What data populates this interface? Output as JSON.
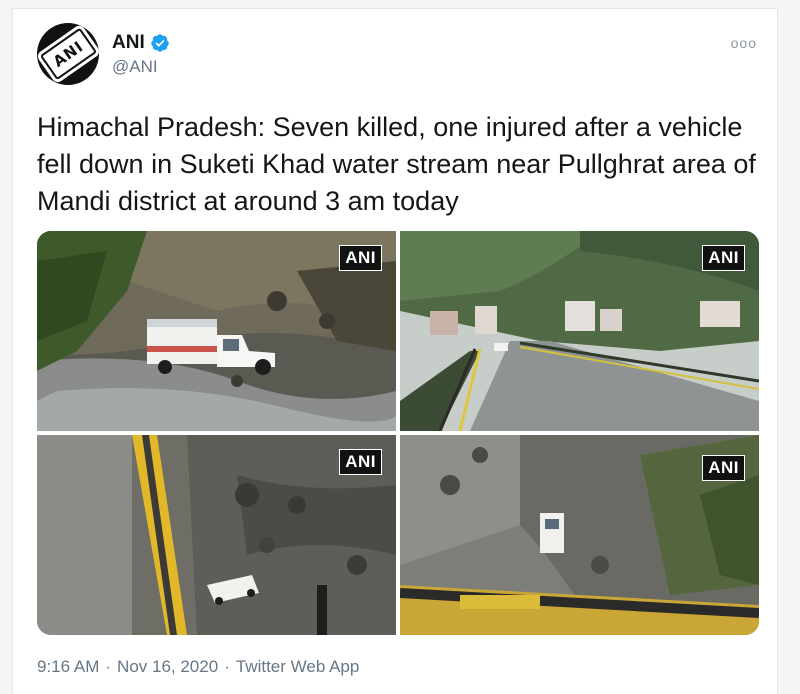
{
  "tweet": {
    "author": {
      "name": "ANI",
      "handle": "@ANI",
      "avatar_text": "ANI",
      "verified_icon": "verified-badge-icon"
    },
    "more_icon": "more-options-icon",
    "text": "Himachal Pradesh: Seven killed, one injured after a vehicle fell down in Suketi Khad water stream near Pullghrat area of Mandi district at around 3 am today",
    "media": [
      {
        "watermark": "ANI",
        "scene": "truck in rocky stream"
      },
      {
        "watermark": "ANI",
        "scene": "bridge road with hillside buildings"
      },
      {
        "watermark": "ANI",
        "scene": "stream below bridge railing"
      },
      {
        "watermark": "ANI",
        "scene": "vehicle in stream from bridge"
      }
    ],
    "meta": {
      "time": "9:16 AM",
      "sep1": "·",
      "date": "Nov 16, 2020",
      "sep2": "·",
      "source": "Twitter Web App"
    }
  },
  "colors": {
    "text": "#14171a",
    "secondary": "#657786",
    "verified": "#1da1f2",
    "border": "#e1e8ed"
  }
}
